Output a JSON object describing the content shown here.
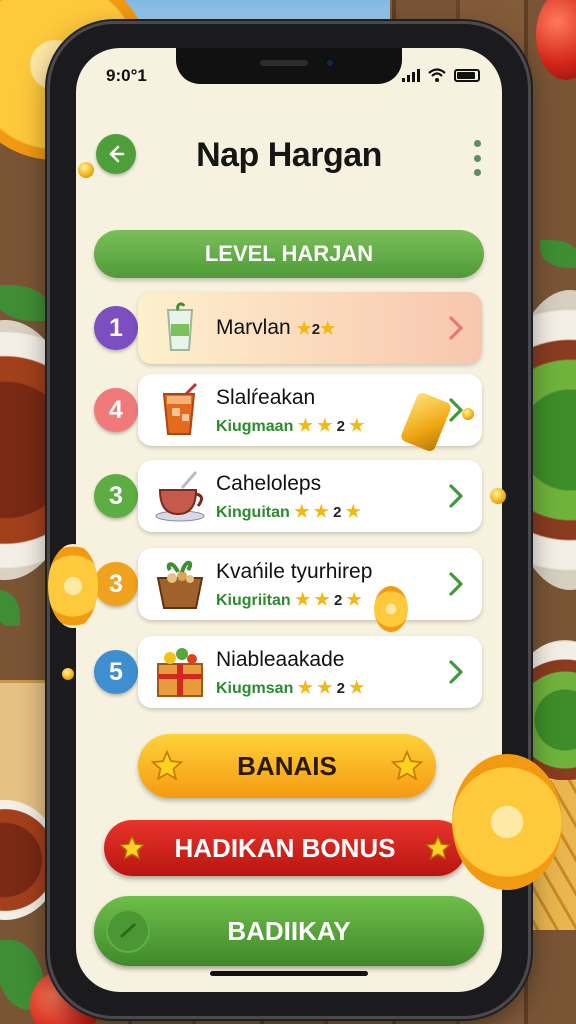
{
  "status_bar": {
    "time": "9:0°1"
  },
  "header": {
    "title": "Nap Hargan"
  },
  "level_banner": {
    "label": "LEVEL HARJAN"
  },
  "items": [
    {
      "rank": "1",
      "rank_color": "#7b4fbf",
      "name": "Marvlan",
      "subtitle": "",
      "rating": "2",
      "icon": "drink-cup-icon"
    },
    {
      "rank": "4",
      "rank_color": "#f07a7a",
      "name": "Slalŕeakan",
      "subtitle": "Kiugmaan",
      "rating": "2",
      "icon": "iced-tea-icon"
    },
    {
      "rank": "3",
      "rank_color": "#5cae43",
      "name": "Caheloleps",
      "subtitle": "Kinguitan",
      "rating": "2",
      "icon": "tea-cup-icon"
    },
    {
      "rank": "3",
      "rank_color": "#f0a21e",
      "name": "Kvańile tyurhirep",
      "subtitle": "Kiugriitan",
      "rating": "2",
      "icon": "basket-icon"
    },
    {
      "rank": "5",
      "rank_color": "#3f8fd0",
      "name": "Niableaakade",
      "subtitle": "Kiugmsan",
      "rating": "2",
      "icon": "gift-box-icon"
    }
  ],
  "buttons": {
    "banais": "BANAIS",
    "bonus": "HADIKAN BONUS",
    "badiikay": "BADIIKAY"
  },
  "colors": {
    "accent_green": "#4f9a37",
    "screen_bg": "#f7f1df",
    "bonus_red": "#c81d15",
    "banais_orange": "#f59a10"
  }
}
